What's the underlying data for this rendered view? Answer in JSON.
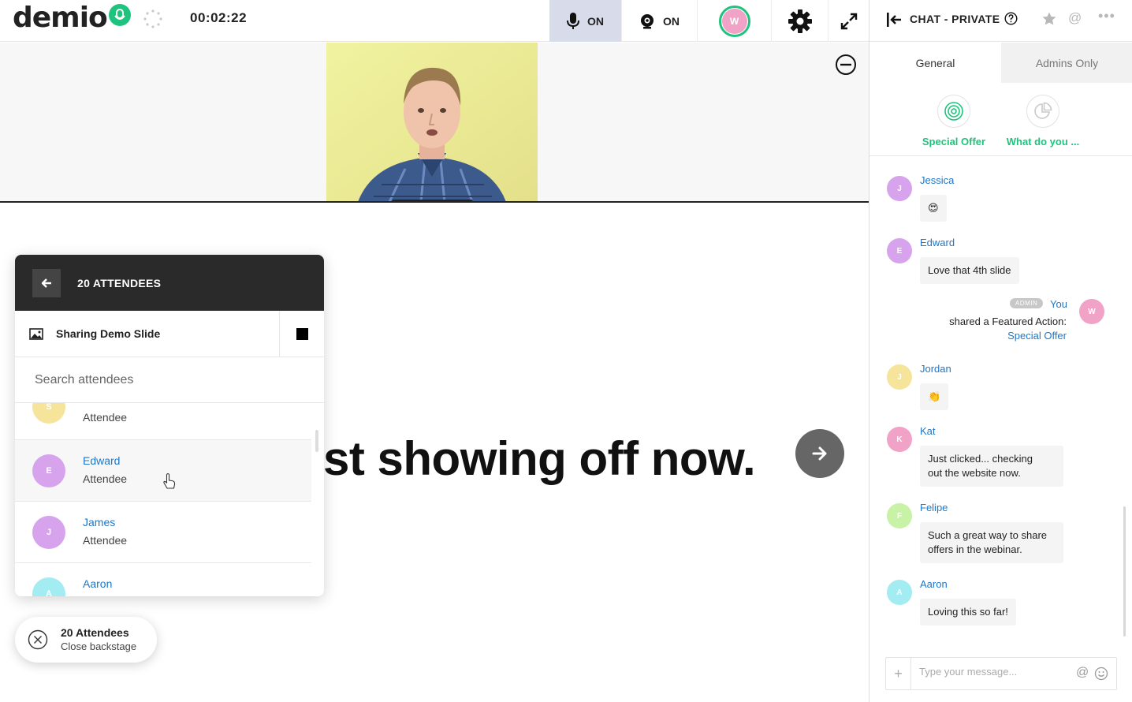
{
  "topbar": {
    "logo_text": "demio",
    "timer": "00:02:22",
    "mic_label": "ON",
    "cam_label": "ON",
    "user_initial": "W",
    "accent": "#1ec47d"
  },
  "stage": {
    "slide_text": "st showing off now."
  },
  "attendees": {
    "title": "20 ATTENDEES",
    "sharing_label": "Sharing Demo Slide",
    "search_placeholder": "Search attendees",
    "items": [
      {
        "initial": "S",
        "name": "",
        "role": "Attendee",
        "color": "#f5e49a"
      },
      {
        "initial": "E",
        "name": "Edward",
        "role": "Attendee",
        "color": "#d7a3ec"
      },
      {
        "initial": "J",
        "name": "James",
        "role": "Attendee",
        "color": "#d7a3ec"
      },
      {
        "initial": "A",
        "name": "Aaron",
        "role": "",
        "color": "#a3ecf2"
      }
    ]
  },
  "toast": {
    "title": "20 Attendees",
    "subtitle": "Close backstage"
  },
  "chat": {
    "title": "CHAT - PRIVATE",
    "tabs": [
      "General",
      "Admins Only"
    ],
    "actions": [
      "Special Offer",
      "What do you ..."
    ],
    "messages": [
      {
        "initial": "J",
        "name": "Jessica",
        "text": "😍",
        "color": "#d7a3ec"
      },
      {
        "initial": "E",
        "name": "Edward",
        "text": "Love that 4th slide",
        "color": "#d7a3ec"
      },
      {
        "initial": "J",
        "name": "Jordan",
        "text": "👏",
        "color": "#f5e49a"
      },
      {
        "initial": "K",
        "name": "Kat",
        "text_lines": [
          "Just clicked... checking",
          "out the website now."
        ],
        "color": "#f1a2c7"
      },
      {
        "initial": "F",
        "name": "Felipe",
        "text_lines": [
          "Such a great way to share",
          "offers in the webinar."
        ],
        "color": "#c8f2a6"
      },
      {
        "initial": "A",
        "name": "Aaron",
        "text": "Loving this so far!",
        "color": "#a3ecf2"
      }
    ],
    "admin_message": {
      "badge": "ADMIN",
      "name": "You",
      "initial": "W",
      "text": "shared a Featured Action:",
      "link": "Special Offer",
      "color": "#f1a2c7"
    },
    "composer_placeholder": "Type your message..."
  }
}
